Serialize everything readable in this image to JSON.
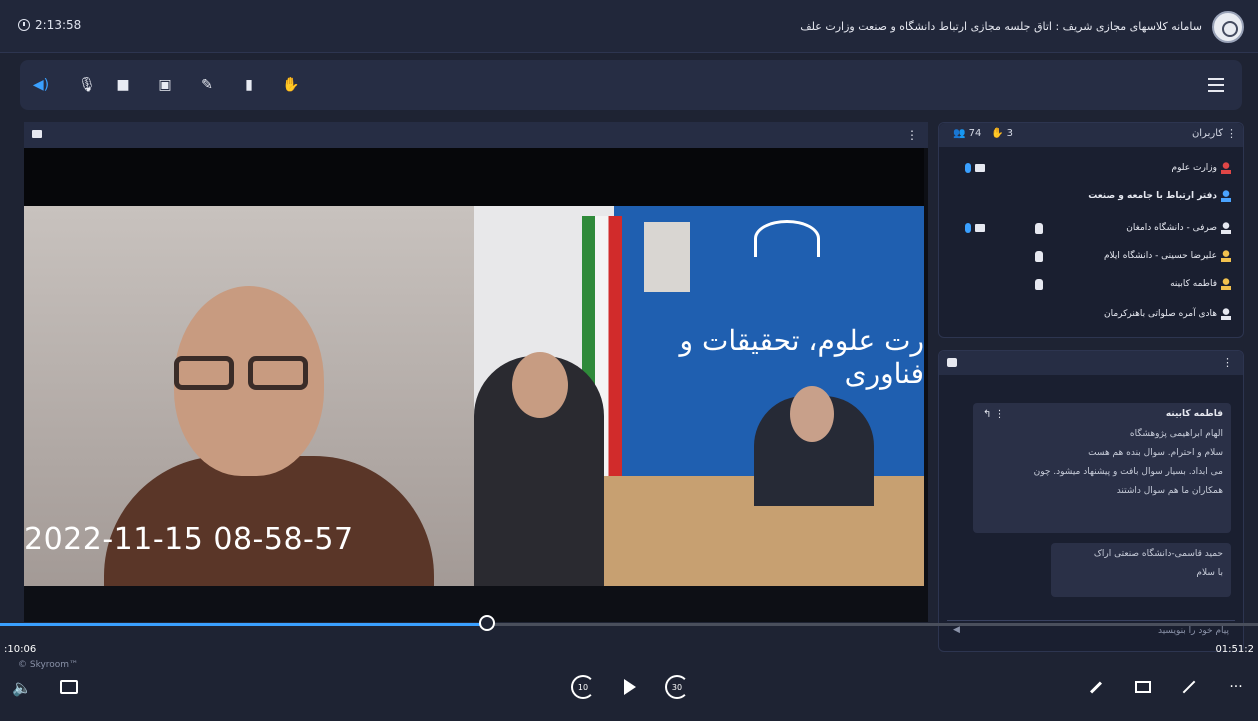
{
  "header": {
    "timer": "2:13:58",
    "title": "سامانه کلاسهای مجازی شریف : اتاق جلسه مجازی ارتباط دانشگاه و صنعت وزارت علف"
  },
  "toolbar": {
    "tools": [
      {
        "icon": "speaker-icon",
        "active": true
      },
      {
        "icon": "microphone-icon",
        "active": false
      },
      {
        "icon": "camera-off-icon",
        "active": false
      },
      {
        "icon": "screen-share-icon",
        "active": false
      },
      {
        "icon": "pen-icon",
        "active": false
      },
      {
        "icon": "lock-icon",
        "active": false
      },
      {
        "icon": "raise-hand-icon",
        "active": false
      }
    ]
  },
  "video": {
    "banner_text": "رت علوم، تحقیقات و فناوری",
    "timestamp": "2022-11-15 08-58-57"
  },
  "users": {
    "title": "کاربران",
    "count": "74",
    "hands": "3",
    "list": [
      {
        "name": "وزارت علوم",
        "color": "red",
        "bold": false,
        "mic": true,
        "cam": true,
        "hand": false
      },
      {
        "name": "دفتر ارتباط با جامعه و صنعت",
        "color": "blue",
        "bold": true,
        "mic": false,
        "cam": false,
        "hand": false
      },
      {
        "name": "صرفی - دانشگاه دامغان",
        "color": "white",
        "bold": false,
        "mic": true,
        "cam": true,
        "hand": true
      },
      {
        "name": "علیرضا حسینی - دانشگاه ایلام",
        "color": "yellow",
        "bold": false,
        "mic": false,
        "cam": false,
        "hand": true
      },
      {
        "name": "فاطمه کابینه",
        "color": "yellow",
        "bold": false,
        "mic": false,
        "cam": false,
        "hand": true
      },
      {
        "name": "هادی آمره صلواتی باهنرکرمان",
        "color": "white",
        "bold": false,
        "mic": false,
        "cam": false,
        "hand": false
      }
    ]
  },
  "chat": {
    "messages": [
      {
        "author": "فاطمه کابینه",
        "lines": [
          "الهام ابراهیمی پژوهشگاه",
          "سلام و احترام. سوال بنده هم هست",
          "می ابداد. بسیار سوال بافت و پیشنهاد میشود. چون",
          "همکاران ما هم سوال داشتند"
        ]
      },
      {
        "author": "",
        "lines": [
          "حمید قاسمی-دانشگاه صنعتی اراک",
          "با سلام"
        ]
      }
    ],
    "input_placeholder": "پیام خود را بنویسید"
  },
  "player": {
    "current_time": ":10:06",
    "duration": "01:51:2",
    "progress": 0.387,
    "watermark": "© Skyroom™"
  },
  "colors": {
    "accent": "#3aa0ff",
    "background": "#1e2333",
    "panel": "#262d44"
  }
}
